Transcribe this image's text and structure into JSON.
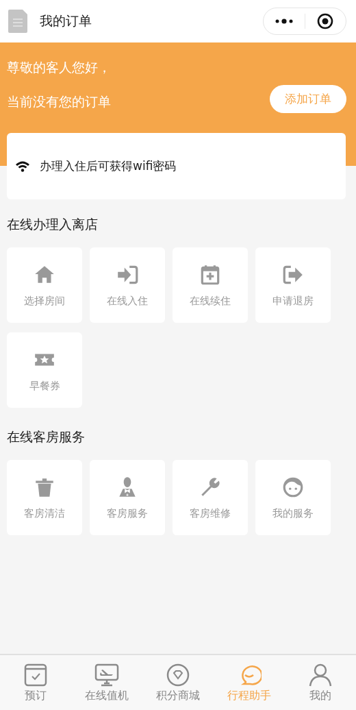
{
  "header": {
    "title": "我的订单"
  },
  "banner": {
    "greeting": "尊敬的客人您好，",
    "message": "当前没有您的订单",
    "button": "添加订单"
  },
  "notice": {
    "text": "办理入住后可获得wifi密码"
  },
  "sections": [
    {
      "title": "在线办理入离店",
      "items": [
        {
          "label": "选择房间"
        },
        {
          "label": "在线入住"
        },
        {
          "label": "在线续住"
        },
        {
          "label": "申请退房"
        },
        {
          "label": "早餐券"
        }
      ]
    },
    {
      "title": "在线客房服务",
      "items": [
        {
          "label": "客房清洁"
        },
        {
          "label": "客房服务"
        },
        {
          "label": "客房维修"
        },
        {
          "label": "我的服务"
        }
      ]
    }
  ],
  "tabs": [
    {
      "label": "预订",
      "selected": false
    },
    {
      "label": "在线值机",
      "selected": false
    },
    {
      "label": "积分商城",
      "selected": false
    },
    {
      "label": "行程助手",
      "selected": true
    },
    {
      "label": "我的",
      "selected": false
    }
  ]
}
